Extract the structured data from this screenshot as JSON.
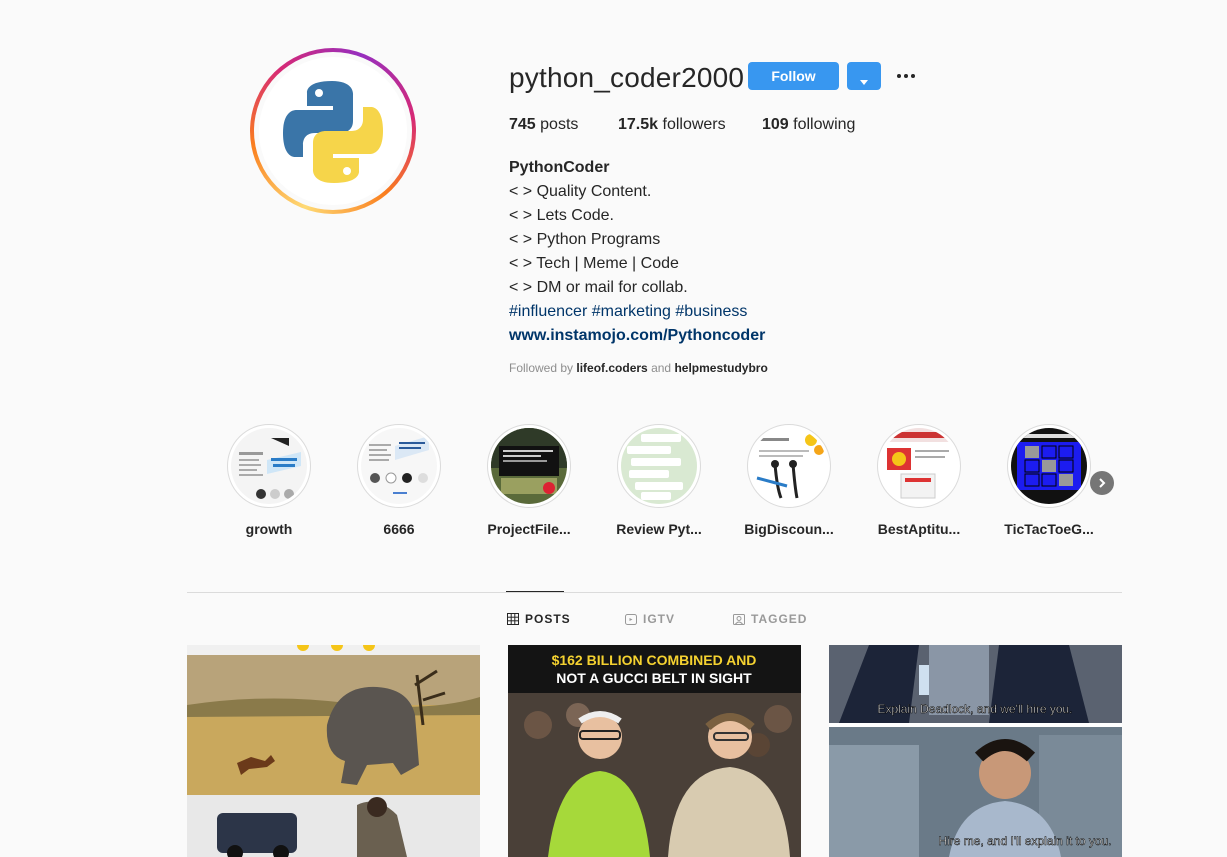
{
  "profile": {
    "username": "python_coder2000",
    "follow_label": "Follow",
    "stats": {
      "posts_count": "745",
      "posts_label": "posts",
      "followers_count": "17.5k",
      "followers_label": "followers",
      "following_count": "109",
      "following_label": "following"
    },
    "bio": {
      "name": "PythonCoder",
      "lines": [
        "< > Quality Content.",
        "< > Lets Code.",
        "< > Python Programs",
        "< > Tech | Meme | Code",
        "< > DM or mail for collab."
      ],
      "hashtags": "#influencer #marketing #business",
      "link": "www.instamojo.com/Pythoncoder"
    },
    "followed_by": {
      "prefix": "Followed by",
      "user1": "lifeof.coders",
      "conjunction": "and",
      "user2": "helpmestudybro"
    }
  },
  "highlights": [
    {
      "label": "growth"
    },
    {
      "label": "6666"
    },
    {
      "label": "ProjectFile..."
    },
    {
      "label": "Review Pyt..."
    },
    {
      "label": "BigDiscoun..."
    },
    {
      "label": "BestAptitu..."
    },
    {
      "label": "TicTacToeG..."
    }
  ],
  "tabs": [
    {
      "label": "POSTS",
      "icon": "grid-icon",
      "active": true
    },
    {
      "label": "IGTV",
      "icon": "igtv-icon",
      "active": false
    },
    {
      "label": "TAGGED",
      "icon": "tagged-icon",
      "active": false
    }
  ],
  "posts": [
    {
      "caption": ""
    },
    {
      "caption_line1": "$162 BILLION COMBINED AND",
      "caption_line2": "NOT A GUCCI BELT IN SIGHT"
    },
    {
      "caption_top": "Explain Deadlock, and we'll hire you.",
      "caption_bottom": "Hire me, and I'll explain it to you."
    }
  ],
  "colors": {
    "primary_button": "#3897f0",
    "link": "#003569",
    "secondary_text": "#8e8e8e",
    "border": "#dbdbdb"
  }
}
